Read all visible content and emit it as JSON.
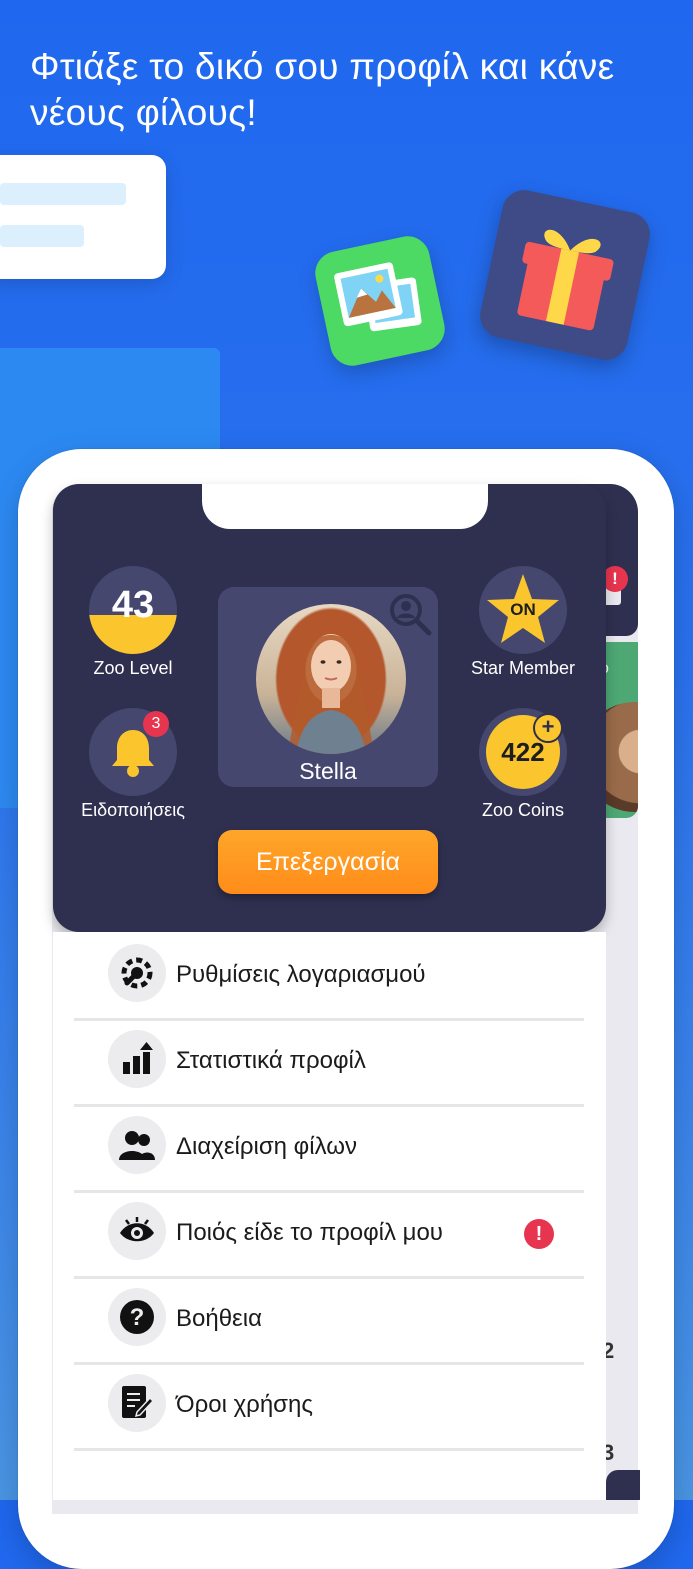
{
  "headline": "Φτιάξε το δικό σου προφίλ και κάνε νέους φίλους!",
  "profile": {
    "name": "Stella",
    "level": {
      "value": "43",
      "label": "Zoo Level",
      "progress_fraction": 0.44
    },
    "star_member": {
      "status": "ON",
      "label": "Star Member"
    },
    "notifications": {
      "count": "3",
      "label": "Ειδοποιήσεις"
    },
    "coins": {
      "value": "422",
      "label": "Zoo Coins",
      "plus": "+"
    },
    "edit_button": "Επεξεργασία"
  },
  "menu": {
    "items": [
      {
        "label": "Ρυθμίσεις λογαριασμού",
        "icon": "account-settings-icon"
      },
      {
        "label": "Στατιστικά προφίλ",
        "icon": "stats-icon"
      },
      {
        "label": "Διαχείριση φίλων",
        "icon": "friends-icon"
      },
      {
        "label": "Ποιός είδε το προφίλ μου",
        "icon": "eye-icon",
        "alert": "!"
      },
      {
        "label": "Βοήθεια",
        "icon": "help-icon"
      },
      {
        "label": "Όροι χρήσης",
        "icon": "terms-icon"
      }
    ]
  },
  "background": {
    "alert": "!",
    "peek_text": "ο",
    "num_a": "2",
    "num_b": "3"
  },
  "colors": {
    "background_blue": "#1f67ee",
    "panel_dark": "#2f3050",
    "accent_yellow": "#fbc52d",
    "button_orange": "#ff9b22",
    "alert_red": "#e8354f"
  }
}
